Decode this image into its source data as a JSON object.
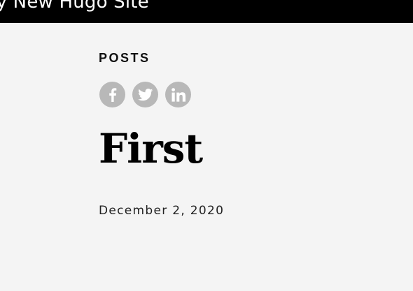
{
  "header": {
    "site_title": "My New Hugo Site"
  },
  "post": {
    "section": "POSTS",
    "title": "First",
    "date": "December 2, 2020"
  },
  "share": {
    "buttons": [
      {
        "icon": "facebook-icon"
      },
      {
        "icon": "twitter-icon"
      },
      {
        "icon": "linkedin-icon"
      }
    ],
    "icon_bg": "#b8b8b8"
  },
  "colors": {
    "header_bg": "#000000",
    "page_bg": "#f4f4f4",
    "text": "#000000"
  }
}
